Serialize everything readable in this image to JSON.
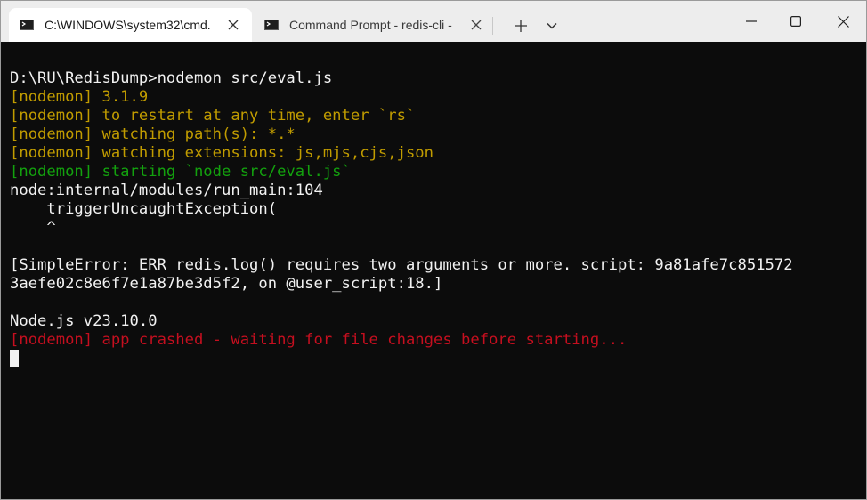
{
  "tabs": [
    {
      "label": "C:\\WINDOWS\\system32\\cmd.",
      "active": true,
      "icon": "terminal-icon"
    },
    {
      "label": "Command Prompt - redis-cli  -",
      "active": false,
      "icon": "terminal-icon"
    }
  ],
  "toolbar": {
    "new_tab_icon": "plus-icon",
    "dropdown_icon": "chevron-down-icon"
  },
  "window_controls": {
    "minimize_icon": "minimize-icon",
    "maximize_icon": "maximize-icon",
    "close_icon": "close-icon"
  },
  "terminal": {
    "background": "#0c0c0c",
    "colors": {
      "white": "#f2f2f2",
      "yellow": "#c19c00",
      "green": "#13a10e",
      "red": "#c50f1f"
    },
    "lines": [
      {
        "text": "D:\\RU\\RedisDump>nodemon src/eval.js",
        "color": "white"
      },
      {
        "text": "[nodemon] 3.1.9",
        "color": "yellow"
      },
      {
        "text": "[nodemon] to restart at any time, enter `rs`",
        "color": "yellow"
      },
      {
        "text": "[nodemon] watching path(s): *.*",
        "color": "yellow"
      },
      {
        "text": "[nodemon] watching extensions: js,mjs,cjs,json",
        "color": "yellow"
      },
      {
        "text": "[nodemon] starting `node src/eval.js`",
        "color": "green"
      },
      {
        "text": "node:internal/modules/run_main:104",
        "color": "white"
      },
      {
        "text": "    triggerUncaughtException(",
        "color": "white"
      },
      {
        "text": "    ^",
        "color": "white"
      },
      {
        "text": "",
        "color": "white"
      },
      {
        "text": "[SimpleError: ERR redis.log() requires two arguments or more. script: 9a81afe7c851572",
        "color": "white"
      },
      {
        "text": "3aefe02c8e6f7e1a87be3d5f2, on @user_script:18.]",
        "color": "white"
      },
      {
        "text": "",
        "color": "white"
      },
      {
        "text": "Node.js v23.10.0",
        "color": "white"
      },
      {
        "text": "[nodemon] app crashed - waiting for file changes before starting...",
        "color": "red"
      }
    ]
  }
}
